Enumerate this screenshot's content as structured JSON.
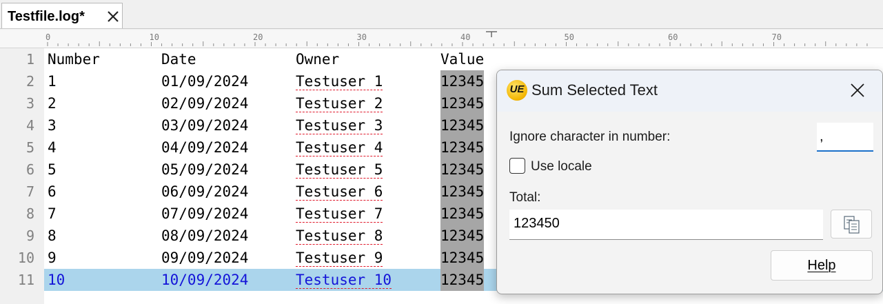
{
  "tab": {
    "title": "Testfile.log*"
  },
  "ruler": {
    "marks": [
      "0",
      "10",
      "20",
      "30",
      "40",
      "50",
      "60",
      "70"
    ]
  },
  "editor": {
    "headers": {
      "number": "Number",
      "date": "Date",
      "owner": "Owner",
      "value": "Value"
    },
    "line_numbers": [
      "1",
      "2",
      "3",
      "4",
      "5",
      "6",
      "7",
      "8",
      "9",
      "10",
      "11"
    ],
    "rows": [
      {
        "number": "1",
        "date": "01/09/2024",
        "owner": "Testuser 1",
        "value": "12345"
      },
      {
        "number": "2",
        "date": "02/09/2024",
        "owner": "Testuser 2",
        "value": "12345"
      },
      {
        "number": "3",
        "date": "03/09/2024",
        "owner": "Testuser 3",
        "value": "12345"
      },
      {
        "number": "4",
        "date": "04/09/2024",
        "owner": "Testuser 4",
        "value": "12345"
      },
      {
        "number": "5",
        "date": "05/09/2024",
        "owner": "Testuser 5",
        "value": "12345"
      },
      {
        "number": "6",
        "date": "06/09/2024",
        "owner": "Testuser 6",
        "value": "12345"
      },
      {
        "number": "7",
        "date": "07/09/2024",
        "owner": "Testuser 7",
        "value": "12345"
      },
      {
        "number": "8",
        "date": "08/09/2024",
        "owner": "Testuser 8",
        "value": "12345"
      },
      {
        "number": "9",
        "date": "09/09/2024",
        "owner": "Testuser 9",
        "value": "12345"
      },
      {
        "number": "10",
        "date": "10/09/2024",
        "owner": "Testuser 10",
        "value": "12345"
      }
    ]
  },
  "dialog": {
    "logo": "UE",
    "title": "Sum Selected Text",
    "ignore_label": "Ignore character in number:",
    "ignore_value": ",",
    "use_locale_label": "Use locale",
    "use_locale_checked": false,
    "total_label": "Total:",
    "total_value": "123450",
    "help_label": "Help"
  },
  "icons": {
    "tab_close": "close-icon",
    "dialog_close": "close-icon",
    "copy": "copy-icon",
    "logo": "ultraedit-logo-icon"
  },
  "colors": {
    "current_line": "#abd5ec",
    "current_text": "#1414d8",
    "selection": "#a6a6a6",
    "spell_underline": "#e0182a",
    "focus_underline": "#1a6fc9"
  }
}
